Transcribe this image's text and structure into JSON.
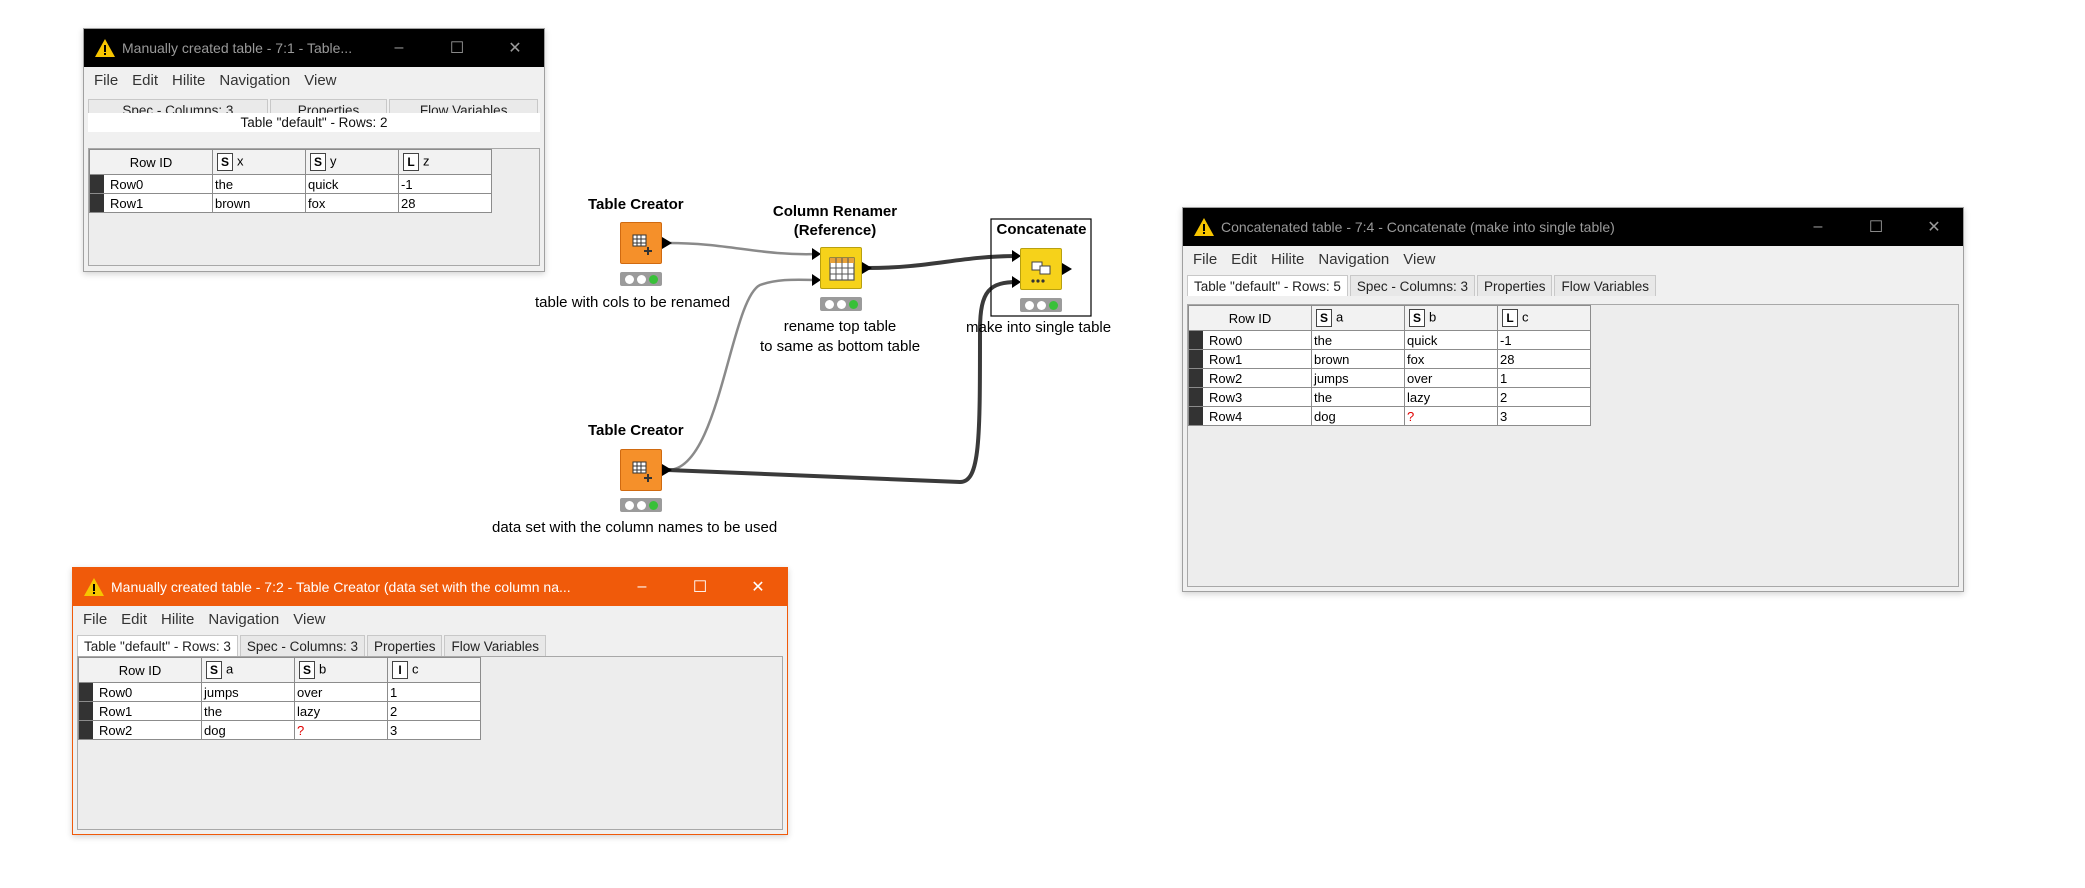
{
  "window1": {
    "title": "Manually created table - 7:1 - Table...",
    "menu": [
      "File",
      "Edit",
      "Hilite",
      "Navigation",
      "View"
    ],
    "tabs": [
      "Spec - Columns: 3",
      "Properties",
      "Flow Variables"
    ],
    "caption": "Table \"default\" - Rows: 2",
    "columns": [
      {
        "header": "Row ID"
      },
      {
        "type": "S",
        "name": "x"
      },
      {
        "type": "S",
        "name": "y"
      },
      {
        "type": "L",
        "name": "z"
      }
    ],
    "rows": [
      [
        "Row0",
        "the",
        "quick",
        "-1"
      ],
      [
        "Row1",
        "brown",
        "fox",
        "28"
      ]
    ]
  },
  "window2": {
    "title": "Manually created table - 7:2 - Table Creator (data set with the column na...",
    "menu": [
      "File",
      "Edit",
      "Hilite",
      "Navigation",
      "View"
    ],
    "tabs": [
      "Table \"default\" - Rows: 3",
      "Spec - Columns: 3",
      "Properties",
      "Flow Variables"
    ],
    "columns": [
      {
        "header": "Row ID"
      },
      {
        "type": "S",
        "name": "a"
      },
      {
        "type": "S",
        "name": "b"
      },
      {
        "type": "I",
        "name": "c"
      }
    ],
    "rows": [
      [
        "Row0",
        "jumps",
        "over",
        "1"
      ],
      [
        "Row1",
        "the",
        "lazy",
        "2"
      ],
      [
        "Row2",
        "dog",
        "?",
        "3"
      ]
    ]
  },
  "window3": {
    "title": "Concatenated table - 7:4 - Concatenate (make into single table)",
    "menu": [
      "File",
      "Edit",
      "Hilite",
      "Navigation",
      "View"
    ],
    "tabs": [
      "Table \"default\" - Rows: 5",
      "Spec - Columns: 3",
      "Properties",
      "Flow Variables"
    ],
    "columns": [
      {
        "header": "Row ID"
      },
      {
        "type": "S",
        "name": "a"
      },
      {
        "type": "S",
        "name": "b"
      },
      {
        "type": "L",
        "name": "c"
      }
    ],
    "rows": [
      [
        "Row0",
        "the",
        "quick",
        "-1"
      ],
      [
        "Row1",
        "brown",
        "fox",
        "28"
      ],
      [
        "Row2",
        "jumps",
        "over",
        "1"
      ],
      [
        "Row3",
        "the",
        "lazy",
        "2"
      ],
      [
        "Row4",
        "dog",
        "?",
        "3"
      ]
    ]
  },
  "window_controls": {
    "minimize": "–",
    "maximize": "☐",
    "close": "✕"
  },
  "workflow": {
    "node1": {
      "title": "Table Creator",
      "label": "table with cols to be renamed",
      "icon": "table-creator-icon"
    },
    "node2": {
      "title": "Table Creator",
      "label": "data set with the column names to be used",
      "icon": "table-creator-icon"
    },
    "node3": {
      "title": "Column Renamer\n(Reference)",
      "label": "rename top table\nto same as bottom table",
      "icon": "column-renamer-icon"
    },
    "node4": {
      "title": "Concatenate",
      "label": "make into single table",
      "icon": "concatenate-icon"
    }
  },
  "colors": {
    "node_orange": "#f5902a",
    "node_yellow": "#f6d21a",
    "status_green": "#38c038",
    "window_orange": "#f05a0a"
  }
}
